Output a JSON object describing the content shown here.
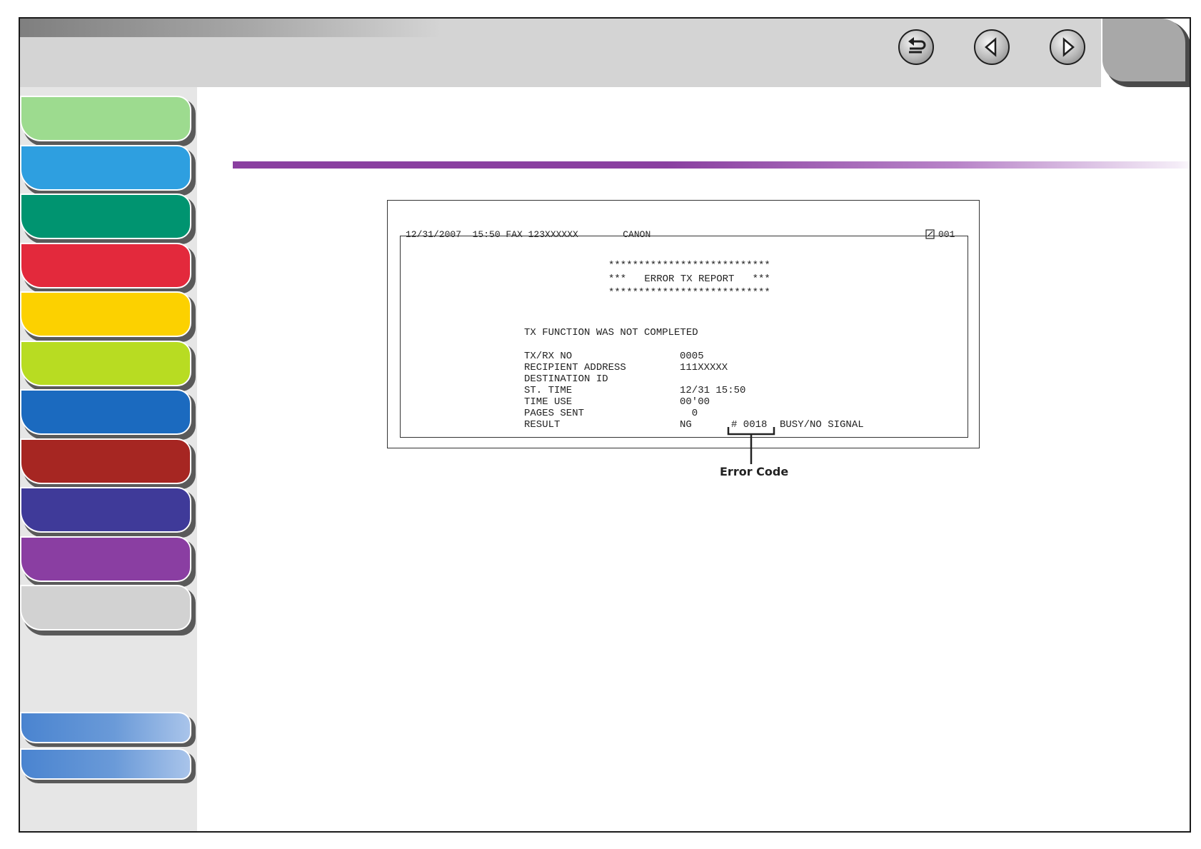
{
  "header": {
    "buttons": [
      {
        "name": "back-button",
        "icon": "return-arrow-icon"
      },
      {
        "name": "previous-page-button",
        "icon": "left-triangle-icon"
      },
      {
        "name": "next-page-button",
        "icon": "right-triangle-icon"
      }
    ]
  },
  "sidebar": {
    "chapter_colors": [
      "#9ddb8f",
      "#2e9fe0",
      "#009470",
      "#e3293c",
      "#fcd100",
      "#b8dc22",
      "#1b6abf",
      "#a62622",
      "#3f3a99",
      "#8a3ea2",
      "#d2d2d2"
    ],
    "footer_tab_colors": [
      "#4a84d0",
      "#4a84d0"
    ]
  },
  "accent": {
    "rule_color": "#8a3fa0"
  },
  "report": {
    "header_line": "12/31/2007  15:50 FAX 123XXXXXX        CANON",
    "page_no": "001",
    "stars": "***************************",
    "title": "***   ERROR TX REPORT   ***",
    "status": "TX FUNCTION WAS NOT COMPLETED",
    "fields": [
      {
        "label": "TX/RX NO",
        "value": "0005"
      },
      {
        "label": "RECIPIENT ADDRESS",
        "value": "111XXXXX"
      },
      {
        "label": "DESTINATION ID",
        "value": ""
      },
      {
        "label": "ST. TIME",
        "value": "12/31 15:50"
      },
      {
        "label": "TIME USE",
        "value": "00'00"
      },
      {
        "label": "PAGES SENT",
        "value": "  0"
      },
      {
        "label": "RESULT",
        "value": "NG"
      }
    ],
    "error_code": "# 0018",
    "error_text": "BUSY/NO SIGNAL"
  },
  "callout": {
    "label": "Error Code"
  }
}
